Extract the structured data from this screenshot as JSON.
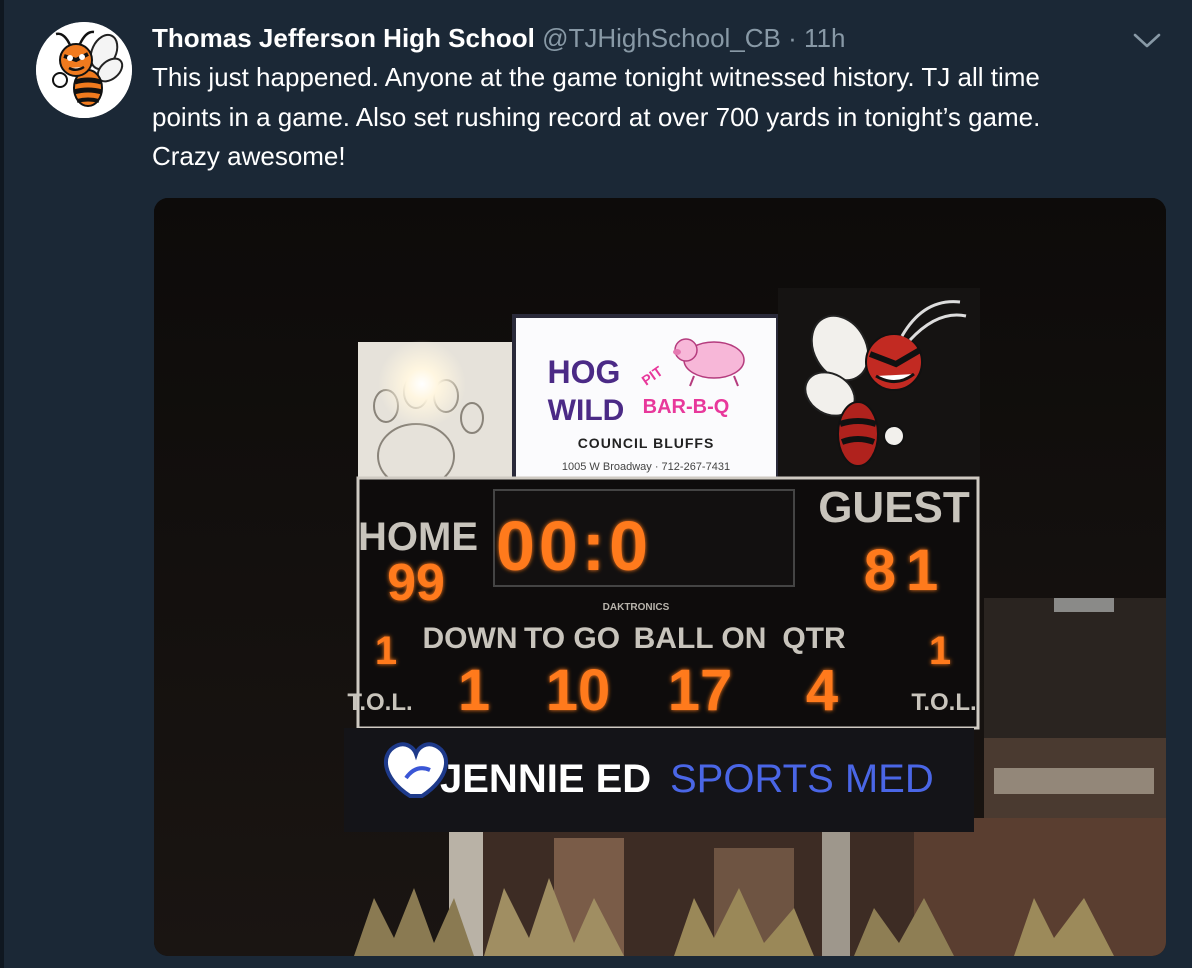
{
  "tweet": {
    "author_name": "Thomas Jefferson High School",
    "handle": "@TJHighSchool_CB",
    "separator": "·",
    "timestamp": "11h",
    "text": "This just happened. Anyone at the game tonight witnessed history. TJ all time\npoints in a game. Also set rushing record at over 700 yards in tonight’s game.\nCrazy awesome!",
    "menu_icon": "chevron-down-icon",
    "avatar_icon": "hornet-mascot-icon"
  },
  "photo": {
    "sign": {
      "line1": "HOG",
      "line2": "WILD",
      "pit": "PIT",
      "barbq": "BAR-B-Q",
      "city": "COUNCIL BLUFFS",
      "address": "1005 W Broadway · 712-267-7431"
    },
    "scoreboard": {
      "home_label": "HOME",
      "home_score": "99",
      "guest_label": "GUEST",
      "guest_score": "81",
      "clock": "00:0",
      "brand": "DAKTRONICS",
      "down_label": "DOWN",
      "down_value": "1",
      "togo_label": "TO GO",
      "togo_value": "10",
      "ballon_label": "BALL ON",
      "ballon_value": "17",
      "qtr_label": "QTR",
      "qtr_value": "4",
      "home_tol_value": "1",
      "guest_tol_value": "1",
      "tol_label": "T.O.L.",
      "sponsor_bold": "JENNIE ED",
      "sponsor_light": "SPORTS MED"
    },
    "colors": {
      "led": "#ff7a1f",
      "led_glow": "#ff3a00",
      "sponsor_blue": "#3a56d6",
      "pig_pink": "#e8389b",
      "hog_purple": "#4b2a86"
    }
  }
}
